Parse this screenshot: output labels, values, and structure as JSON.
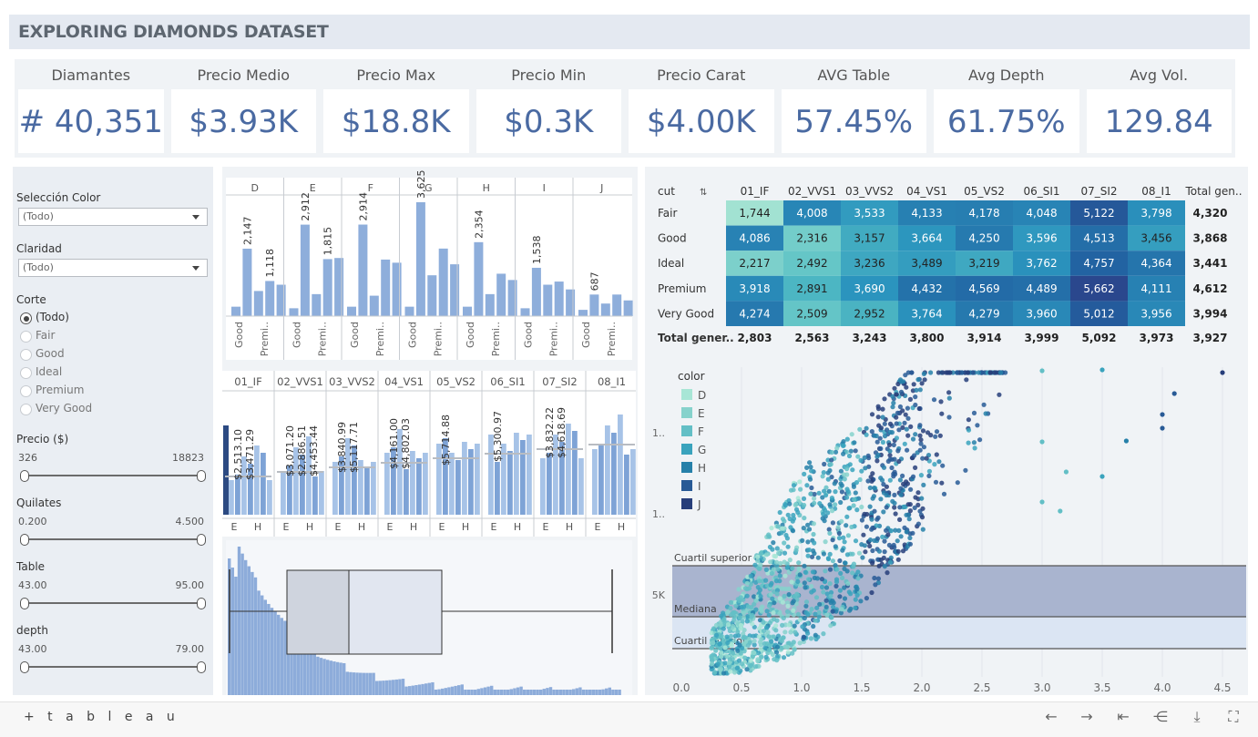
{
  "title": "EXPLORING DIAMONDS DATASET",
  "kpis": [
    {
      "label": "Diamantes",
      "value": "# 40,351"
    },
    {
      "label": "Precio Medio",
      "value": "$3.93K"
    },
    {
      "label": "Precio Max",
      "value": "$18.8K"
    },
    {
      "label": "Precio Min",
      "value": "$0.3K"
    },
    {
      "label": "Precio Carat",
      "value": "$4.00K"
    },
    {
      "label": "AVG Table",
      "value": "57.45%"
    },
    {
      "label": "Avg Depth",
      "value": "61.75%"
    },
    {
      "label": "Avg Vol.",
      "value": "129.84"
    }
  ],
  "filters": {
    "color": {
      "label": "Selección Color",
      "value": "(Todo)"
    },
    "clarity": {
      "label": "Claridad",
      "value": "(Todo)"
    },
    "cut": {
      "label": "Corte",
      "options": [
        "(Todo)",
        "Fair",
        "Good",
        "Ideal",
        "Premium",
        "Very Good"
      ],
      "selected": "(Todo)"
    },
    "price": {
      "label": "Precio ($)",
      "min": "326",
      "max": "18823"
    },
    "carat": {
      "label": "Quilates",
      "min": "0.200",
      "max": "4.500"
    },
    "table": {
      "label": "Table",
      "min": "43.00",
      "max": "95.00"
    },
    "depth": {
      "label": "depth",
      "min": "43.00",
      "max": "79.00"
    }
  },
  "color_bars": {
    "columns": [
      "D",
      "E",
      "F",
      "G",
      "H",
      "I",
      "J"
    ],
    "labels": [
      [
        "2,147",
        "1,118"
      ],
      [
        "2,912",
        "1,815"
      ],
      [
        "2,914"
      ],
      [
        "3,625"
      ],
      [
        "2,354"
      ],
      [
        "1,538"
      ],
      [
        "687"
      ]
    ],
    "xlabels": [
      "Good",
      "Premi.."
    ],
    "values": [
      [
        300,
        2147,
        800,
        1118,
        1000
      ],
      [
        250,
        2912,
        700,
        1815,
        1850
      ],
      [
        300,
        2914,
        650,
        1800,
        1700
      ],
      [
        300,
        3625,
        1300,
        2150,
        1650
      ],
      [
        300,
        2354,
        700,
        1350,
        1150
      ],
      [
        250,
        1538,
        1000,
        1100,
        850
      ],
      [
        200,
        687,
        400,
        687,
        500
      ]
    ]
  },
  "clarity_bars": {
    "columns": [
      "01_IF",
      "02_VVS1",
      "03_VVS2",
      "04_VS1",
      "05_VS2",
      "06_SI1",
      "07_SI2",
      "08_I1"
    ],
    "labels": [
      [
        "$2,513.10",
        "$3,471.29"
      ],
      [
        "$3,071.20",
        "$2,886.51",
        "$4,453.44"
      ],
      [
        "$3,840.99",
        "$5,117.71"
      ],
      [
        "$4,161.00",
        "$4,802.03"
      ],
      [
        "$5,714.88"
      ],
      [
        "$5,300.97"
      ],
      [
        "$3,832.22",
        "$4,618.69"
      ],
      []
    ],
    "xlabels": [
      "E",
      "H"
    ]
  },
  "crosstab": {
    "corner": "cut",
    "sort_icon": "sort-ascending-icon",
    "columns": [
      "01_IF",
      "02_VVS1",
      "03_VVS2",
      "04_VS1",
      "05_VS2",
      "06_SI1",
      "07_SI2",
      "08_I1",
      "Total gen.."
    ],
    "rows": [
      {
        "label": "Fair",
        "values": [
          "1,744",
          "4,008",
          "3,533",
          "4,133",
          "4,178",
          "4,048",
          "5,122",
          "3,798"
        ],
        "total": "4,320"
      },
      {
        "label": "Good",
        "values": [
          "4,086",
          "2,316",
          "3,157",
          "3,664",
          "4,250",
          "3,596",
          "4,513",
          "3,456"
        ],
        "total": "3,868"
      },
      {
        "label": "Ideal",
        "values": [
          "2,217",
          "2,492",
          "3,236",
          "3,489",
          "3,219",
          "3,762",
          "4,757",
          "4,364"
        ],
        "total": "3,441"
      },
      {
        "label": "Premium",
        "values": [
          "3,918",
          "2,891",
          "3,690",
          "4,432",
          "4,569",
          "4,489",
          "5,662",
          "4,111"
        ],
        "total": "4,612"
      },
      {
        "label": "Very Good",
        "values": [
          "4,274",
          "2,509",
          "2,952",
          "3,764",
          "4,279",
          "3,960",
          "5,012",
          "3,956"
        ],
        "total": "3,994"
      }
    ],
    "totals": {
      "label": "Total gener..",
      "values": [
        "2,803",
        "2,563",
        "3,243",
        "3,800",
        "3,914",
        "3,999",
        "5,092",
        "3,973"
      ],
      "total": "3,927"
    }
  },
  "scatter": {
    "legend_title": "color",
    "legend": [
      "D",
      "E",
      "F",
      "G",
      "H",
      "I",
      "J"
    ],
    "legend_colors": [
      "#a8e6d6",
      "#86d2cc",
      "#63bfc6",
      "#3aa3bd",
      "#2680a9",
      "#285a96",
      "#273e7a"
    ],
    "x_ticks": [
      "0.0",
      "0.5",
      "1.0",
      "1.5",
      "2.0",
      "2.5",
      "3.0",
      "3.5",
      "4.0",
      "4.5"
    ],
    "y_ticks": [
      "1..",
      "1..",
      "5K"
    ],
    "bands": [
      "Cuartil superior",
      "Mediana",
      "Cuartil inferior"
    ]
  },
  "footer": {
    "logo": "+ t a b l e a u"
  }
}
